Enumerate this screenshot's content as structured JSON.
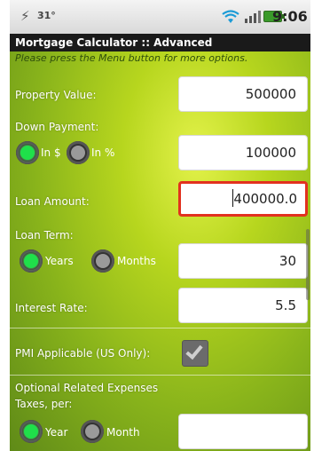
{
  "status_bar": {
    "temperature": "31°",
    "time": "9:06",
    "usb_icon": "usb-icon",
    "wifi_icon": "wifi-icon",
    "signal_icon": "signal-icon",
    "battery_icon": "battery-icon"
  },
  "title": "Mortgage Calculator :: Advanced",
  "hint": "Please press the Menu button for more options.",
  "form": {
    "property_value_label": "Property Value:",
    "property_value": "500000",
    "down_payment_label": "Down Payment:",
    "down_payment_in_dollars_label": "In $",
    "down_payment_in_percent_label": "In %",
    "down_payment_unit_selected": "In $",
    "down_payment": "100000",
    "loan_amount_label": "Loan Amount:",
    "loan_amount": "400000.0",
    "loan_term_label": "Loan Term:",
    "loan_term_years_label": "Years",
    "loan_term_months_label": "Months",
    "loan_term_unit_selected": "Years",
    "loan_term": "30",
    "interest_rate_label": "Interest Rate:",
    "interest_rate": "5.5",
    "pmi_label": "PMI Applicable (US Only):",
    "pmi_checked": true,
    "optional_expenses_label": "Optional Related Expenses",
    "taxes_label": "Taxes, per:",
    "taxes_year_label": "Year",
    "taxes_month_label": "Month",
    "taxes_unit_selected": "Year",
    "taxes_value": ""
  },
  "colors": {
    "accent_green": "#1fe04a",
    "focus_red": "#e2311f",
    "background_green": "#b7d61e",
    "titlebar": "#1a1a1a"
  }
}
